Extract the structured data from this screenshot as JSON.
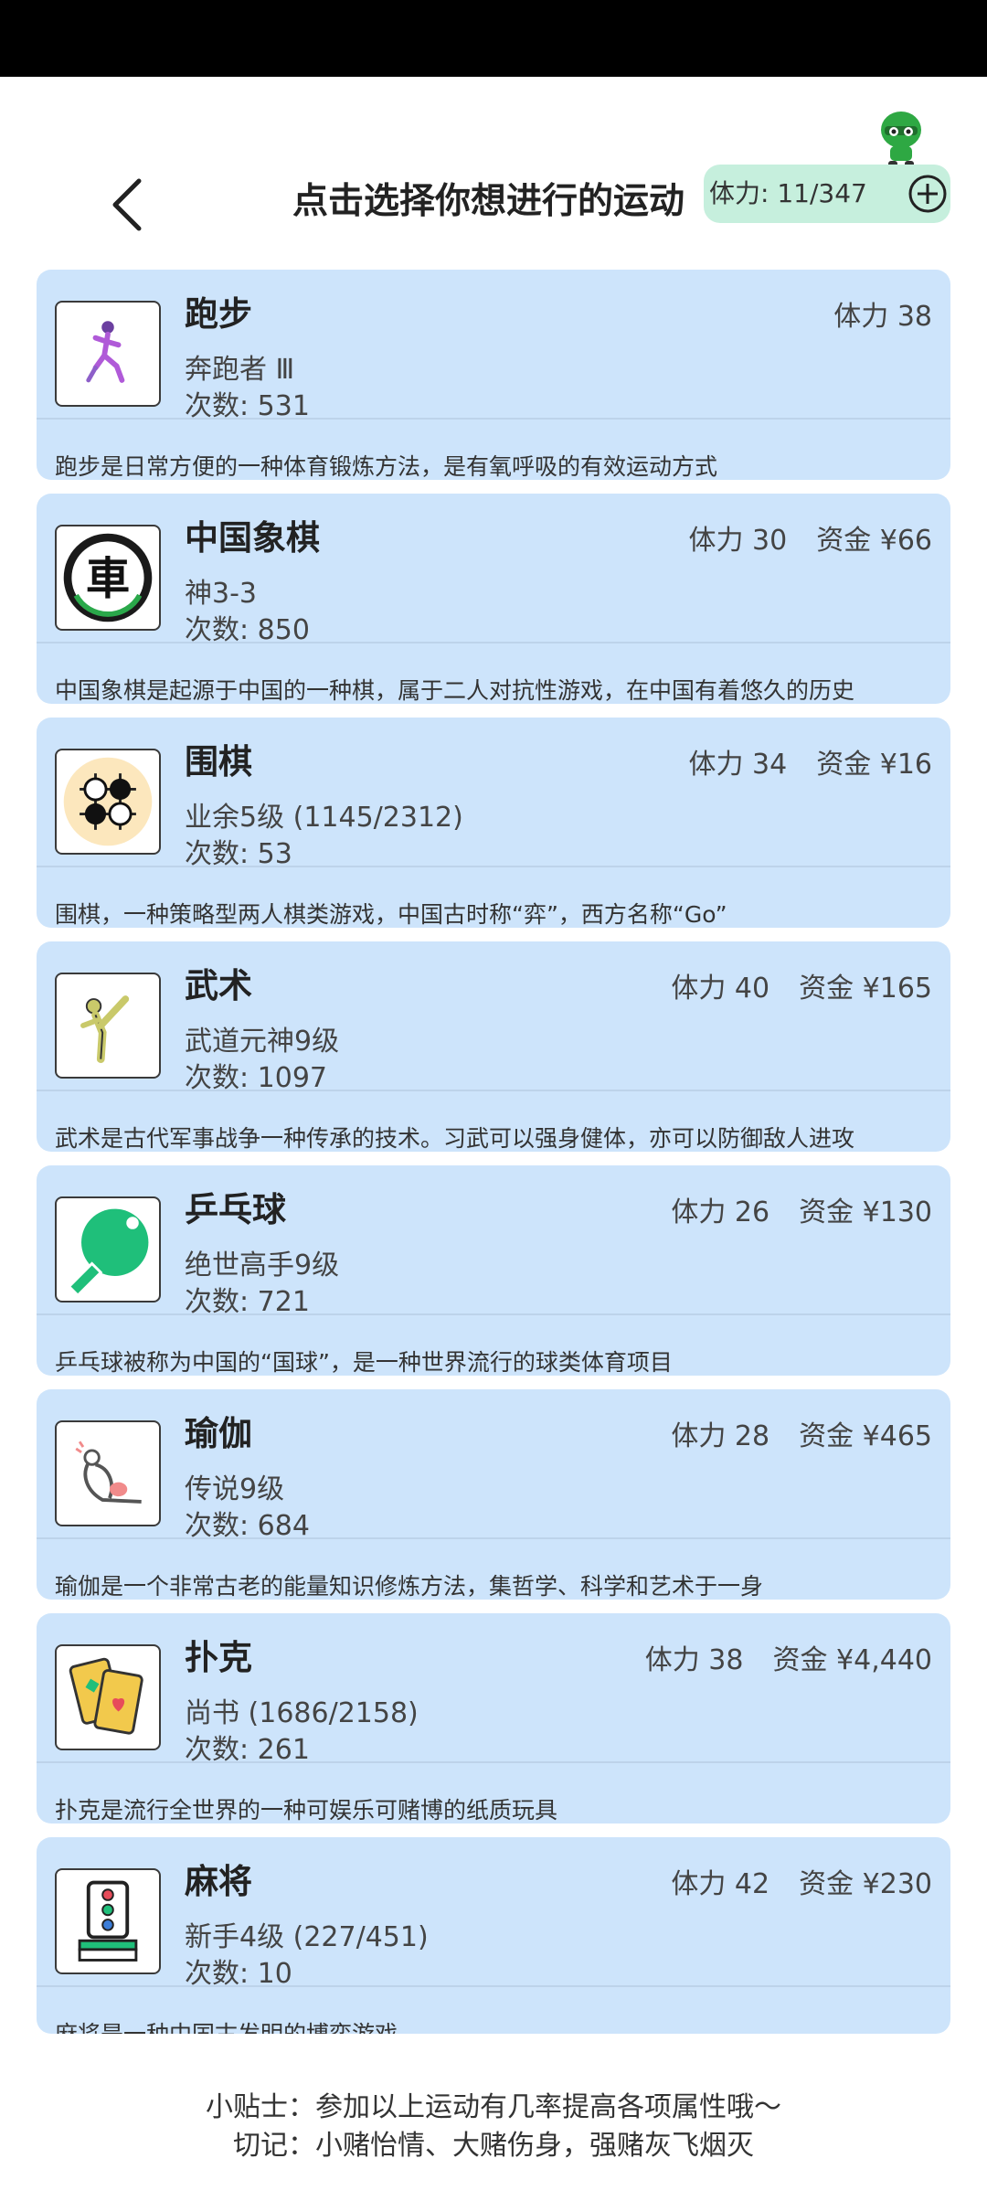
{
  "header": {
    "title": "点击选择你想进行的运动",
    "stamina": "体力: 11/347"
  },
  "activities": [
    {
      "name": "跑步",
      "stamina": "体力 38",
      "money": "",
      "rank": "奔跑者 Ⅲ",
      "count": "次数: 531",
      "description": "跑步是日常方便的一种体育锻炼方法，是有氧呼吸的有效运动方式",
      "icon": "running-icon"
    },
    {
      "name": "中国象棋",
      "stamina": "体力 30",
      "money": "资金 ¥66",
      "rank": "神3-3",
      "count": "次数: 850",
      "description": "中国象棋是起源于中国的一种棋，属于二人对抗性游戏，在中国有着悠久的历史",
      "icon": "chariot-chess-icon",
      "icon_char": "車"
    },
    {
      "name": "围棋",
      "stamina": "体力 34",
      "money": "资金 ¥16",
      "rank": "业余5级 (1145/2312)",
      "count": "次数: 53",
      "description": "围棋，一种策略型两人棋类游戏，中国古时称“弈”，西方名称“Go”",
      "icon": "go-stones-icon"
    },
    {
      "name": "武术",
      "stamina": "体力 40",
      "money": "资金 ¥165",
      "rank": "武道元神9级",
      "count": "次数: 1097",
      "description": "武术是古代军事战争一种传承的技术。习武可以强身健体，亦可以防御敌人进攻",
      "icon": "martial-arts-icon"
    },
    {
      "name": "乒乓球",
      "stamina": "体力 26",
      "money": "资金 ¥130",
      "rank": "绝世高手9级",
      "count": "次数: 721",
      "description": "乒乓球被称为中国的“国球”，是一种世界流行的球类体育项目",
      "icon": "ping-pong-paddle-icon"
    },
    {
      "name": "瑜伽",
      "stamina": "体力 28",
      "money": "资金 ¥465",
      "rank": "传说9级",
      "count": "次数: 684",
      "description": "瑜伽是一个非常古老的能量知识修炼方法，集哲学、科学和艺术于一身",
      "icon": "yoga-icon"
    },
    {
      "name": "扑克",
      "stamina": "体力 38",
      "money": "资金 ¥4,440",
      "rank": "尚书 (1686/2158)",
      "count": "次数: 261",
      "description": "扑克是流行全世界的一种可娱乐可赌博的纸质玩具",
      "icon": "playing-cards-icon"
    },
    {
      "name": "麻将",
      "stamina": "体力 42",
      "money": "资金 ¥230",
      "rank": "新手4级 (227/451)",
      "count": "次数: 10",
      "description": "麻将是一种中国古发明的博弈游戏",
      "icon": "mahjong-tile-icon"
    }
  ],
  "tips": {
    "line1": "小贴士：参加以上运动有几率提高各项属性哦～",
    "line2": "切记：小赌怡情、大赌伤身，强赌灰飞烟灭"
  }
}
